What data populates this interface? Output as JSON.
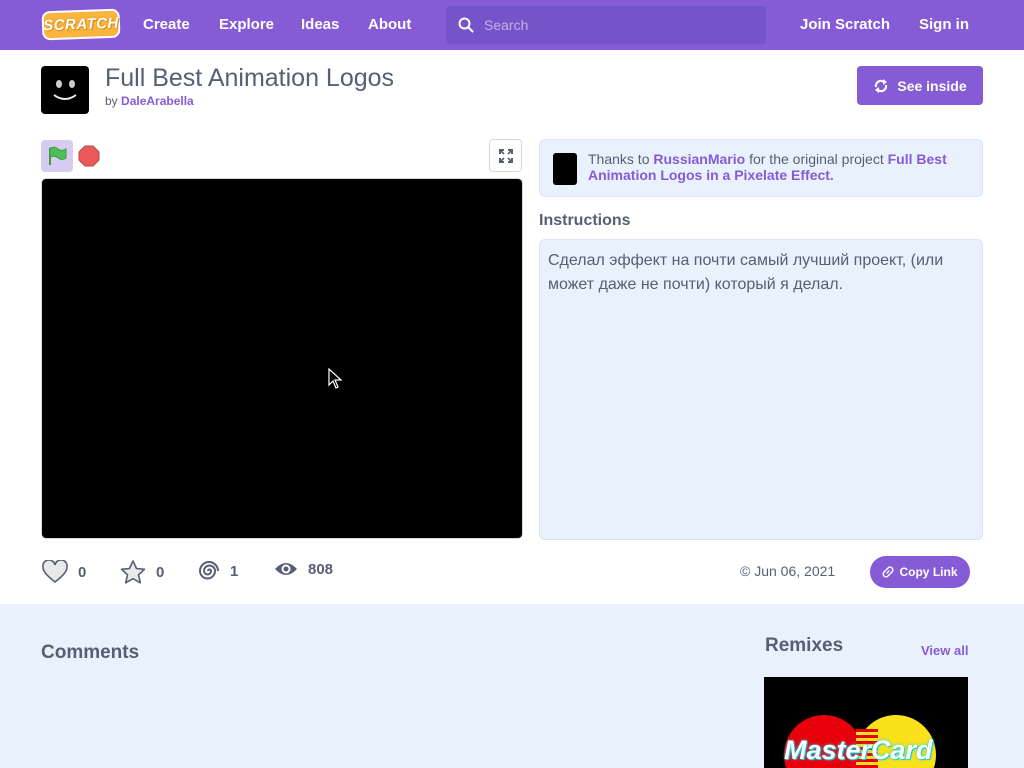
{
  "nav": {
    "logo": "SCRATCH",
    "links": [
      "Create",
      "Explore",
      "Ideas",
      "About"
    ],
    "search_placeholder": "Search",
    "join": "Join Scratch",
    "signin": "Sign in"
  },
  "project": {
    "title": "Full Best Animation Logos",
    "by_prefix": "by",
    "author": "DaleArabella",
    "see_inside": "See inside"
  },
  "remix_notice": {
    "prefix": "Thanks to",
    "user": "RussianMario",
    "middle": "for the original project",
    "original_title": "Full Best Animation Logos in a Pixelate Effect."
  },
  "instructions": {
    "heading": "Instructions",
    "text": "Сделал эффект на почти самый лучший проект, (или может даже не почти) который я делал."
  },
  "stats": {
    "loves": "0",
    "favorites": "0",
    "remixes": "1",
    "views": "808",
    "date": "Jun 06, 2021",
    "copy_link": "Copy Link"
  },
  "comments": {
    "heading": "Comments"
  },
  "remixes": {
    "heading": "Remixes",
    "view_all": "View all",
    "card_text": "MasterCard"
  },
  "colors": {
    "brand": "#855cd6",
    "background": "#e9f1fc",
    "text": "#575e75",
    "flag": "#4cbf56",
    "stop": "#ec5959"
  }
}
